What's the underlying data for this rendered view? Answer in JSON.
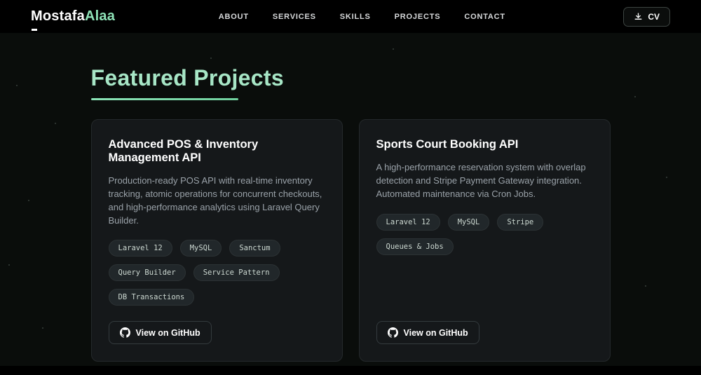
{
  "navbar": {
    "logo": {
      "first": "Mostafa",
      "second": "Alaa"
    },
    "links": [
      {
        "label": "ABOUT"
      },
      {
        "label": "SERVICES"
      },
      {
        "label": "SKILLS"
      },
      {
        "label": "PROJECTS"
      },
      {
        "label": "CONTACT"
      }
    ],
    "cv_button_label": "CV"
  },
  "section": {
    "title": "Featured Projects"
  },
  "projects": [
    {
      "title": "Advanced POS & Inventory Management API",
      "description": "Production-ready POS API with real-time inventory tracking, atomic operations for concurrent checkouts, and high-performance analytics using Laravel Query Builder.",
      "tags": [
        "Laravel 12",
        "MySQL",
        "Sanctum",
        "Query Builder",
        "Service Pattern",
        "DB Transactions"
      ],
      "link_label": "View on GitHub"
    },
    {
      "title": "Sports Court Booking API",
      "description": "A high-performance reservation system with overlap detection and Stripe Payment Gateway integration. Automated maintenance via Cron Jobs.",
      "tags": [
        "Laravel 12",
        "MySQL",
        "Stripe",
        "Queues & Jobs"
      ],
      "link_label": "View on GitHub"
    }
  ],
  "colors": {
    "accent": "#8fe3b8",
    "heading": "#a7e6c6",
    "navbar_background": "#000000",
    "page_background": "#0a0d0b",
    "card_background": "#15181a"
  }
}
